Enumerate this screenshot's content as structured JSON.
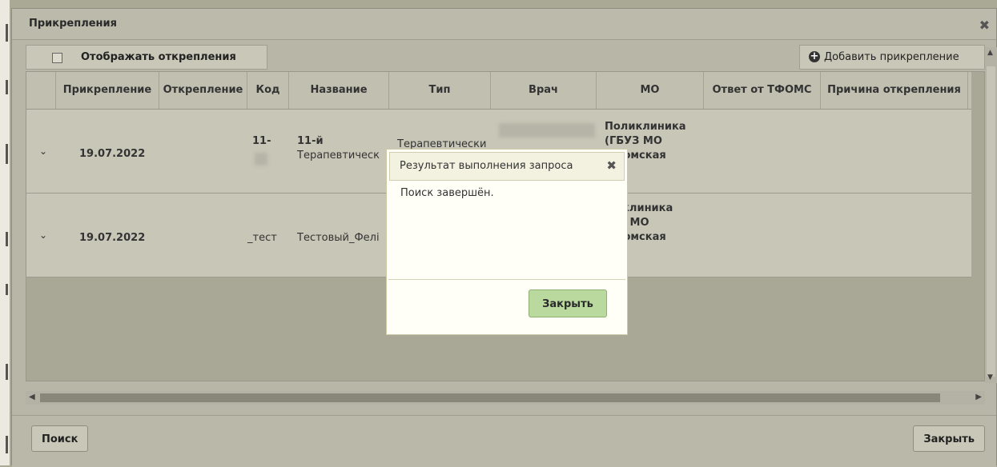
{
  "window": {
    "title": "Прикрепления"
  },
  "toolbar": {
    "show_detachments_label": "Отображать открепления",
    "add_attachment_label": "Добавить прикрепление"
  },
  "table": {
    "columns": [
      "Прикрепление",
      "Открепление",
      "Код",
      "Название",
      "Тип",
      "Врач",
      "МО",
      "Ответ от ТФОМС",
      "Причина открепления"
    ],
    "rows": [
      {
        "attach_date": "19.07.2022",
        "code": "11-",
        "name": [
          "11-й",
          "Терапевтическ"
        ],
        "type": "Терапевтически",
        "mo": [
          "Поликлиника",
          "(ГБУЗ МО",
          "домская",
          "\")"
        ]
      },
      {
        "attach_date": "19.07.2022",
        "code": "_тест",
        "name": [
          "Тестовый_Фелі"
        ],
        "type": "",
        "mo": [
          "иклиника",
          "/З МО",
          "домская",
          "\")"
        ]
      }
    ]
  },
  "footer": {
    "search_label": "Поиск",
    "close_label": "Закрыть"
  },
  "dialog": {
    "title": "Результат выполнения запроса",
    "message": "Поиск завершён.",
    "close_label": "Закрыть"
  }
}
